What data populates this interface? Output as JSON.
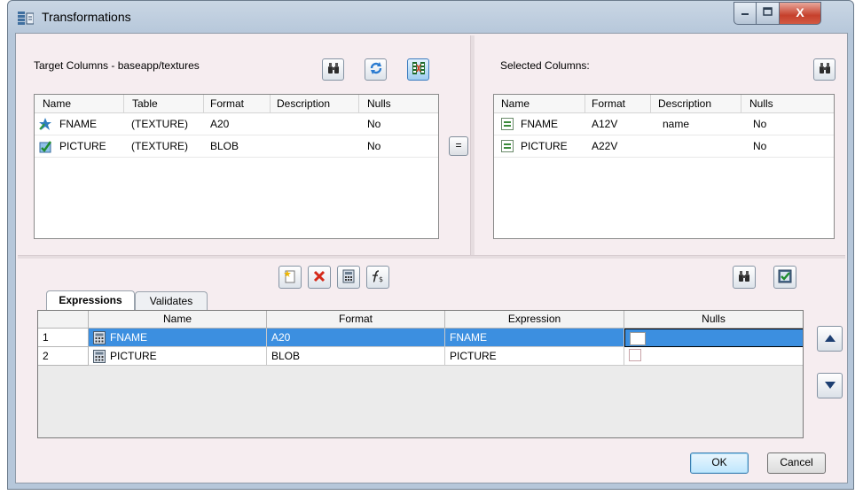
{
  "window": {
    "title": "Transformations",
    "min_icon": "minimize-icon",
    "max_icon": "maximize-icon",
    "close_glyph": "X"
  },
  "target": {
    "label": "Target Columns - baseapp/textures",
    "columns": [
      "Name",
      "Table",
      "Format",
      "Description",
      "Nulls"
    ],
    "rows": [
      {
        "name": "FNAME",
        "table": "(TEXTURE)",
        "format": "A20",
        "description": "",
        "nulls": "No",
        "icon": "key-column-icon"
      },
      {
        "name": "PICTURE",
        "table": "(TEXTURE)",
        "format": "BLOB",
        "description": "",
        "nulls": "No",
        "icon": "check-column-icon"
      }
    ]
  },
  "equal_button": "=",
  "selected": {
    "label": "Selected Columns:",
    "columns": [
      "Name",
      "Format",
      "Description",
      "Nulls"
    ],
    "rows": [
      {
        "name": "FNAME",
        "format": "A12V",
        "description": "name",
        "nulls": "No"
      },
      {
        "name": "PICTURE",
        "format": "A22V",
        "description": "",
        "nulls": "No"
      }
    ]
  },
  "tabs": [
    "Expressions",
    "Validates"
  ],
  "expressions": {
    "columns": [
      "Name",
      "Format",
      "Expression",
      "Nulls"
    ],
    "rows": [
      {
        "num": "1",
        "name": "FNAME",
        "format": "A20",
        "expression": "FNAME",
        "nulls": false,
        "selected": true
      },
      {
        "num": "2",
        "name": "PICTURE",
        "format": "BLOB",
        "expression": "PICTURE",
        "nulls": false,
        "selected": false
      }
    ]
  },
  "buttons": {
    "ok": "OK",
    "cancel": "Cancel"
  },
  "colors": {
    "selection": "#3c8fe0",
    "client_bg": "#f6edf0",
    "frame": "#b6c7da"
  }
}
